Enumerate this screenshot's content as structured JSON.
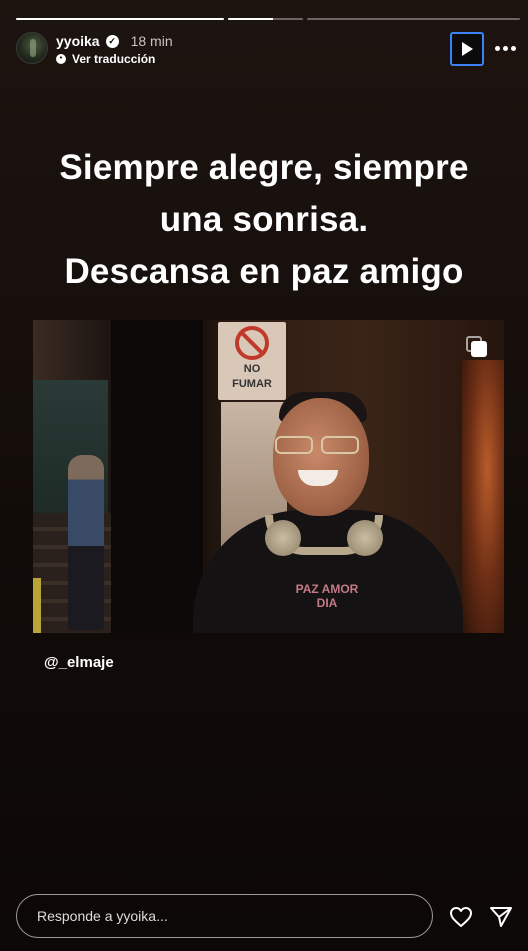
{
  "progress": {
    "segments": 3,
    "completed_segments": 1,
    "current_segment_fill": 0.25
  },
  "header": {
    "username": "yyoika",
    "time": "18 min",
    "translate_label": "Ver traducción",
    "play_icon": "play-icon",
    "more_icon": "more-horizontal-icon"
  },
  "story": {
    "caption_lines": [
      "Siempre alegre, siempre",
      "una sonrisa.",
      "Descansa en paz amigo"
    ],
    "photo_sign_top": "NO",
    "photo_sign_bottom": "FUMAR",
    "shirt_text": "PAZ AMOR DIA",
    "mention": "@_elmaje"
  },
  "footer": {
    "reply_placeholder": "Responde a yyoika...",
    "like_icon": "heart-icon",
    "share_icon": "send-icon"
  },
  "colors": {
    "accent_focus": "#3b82f6",
    "background": "#1d1410"
  }
}
